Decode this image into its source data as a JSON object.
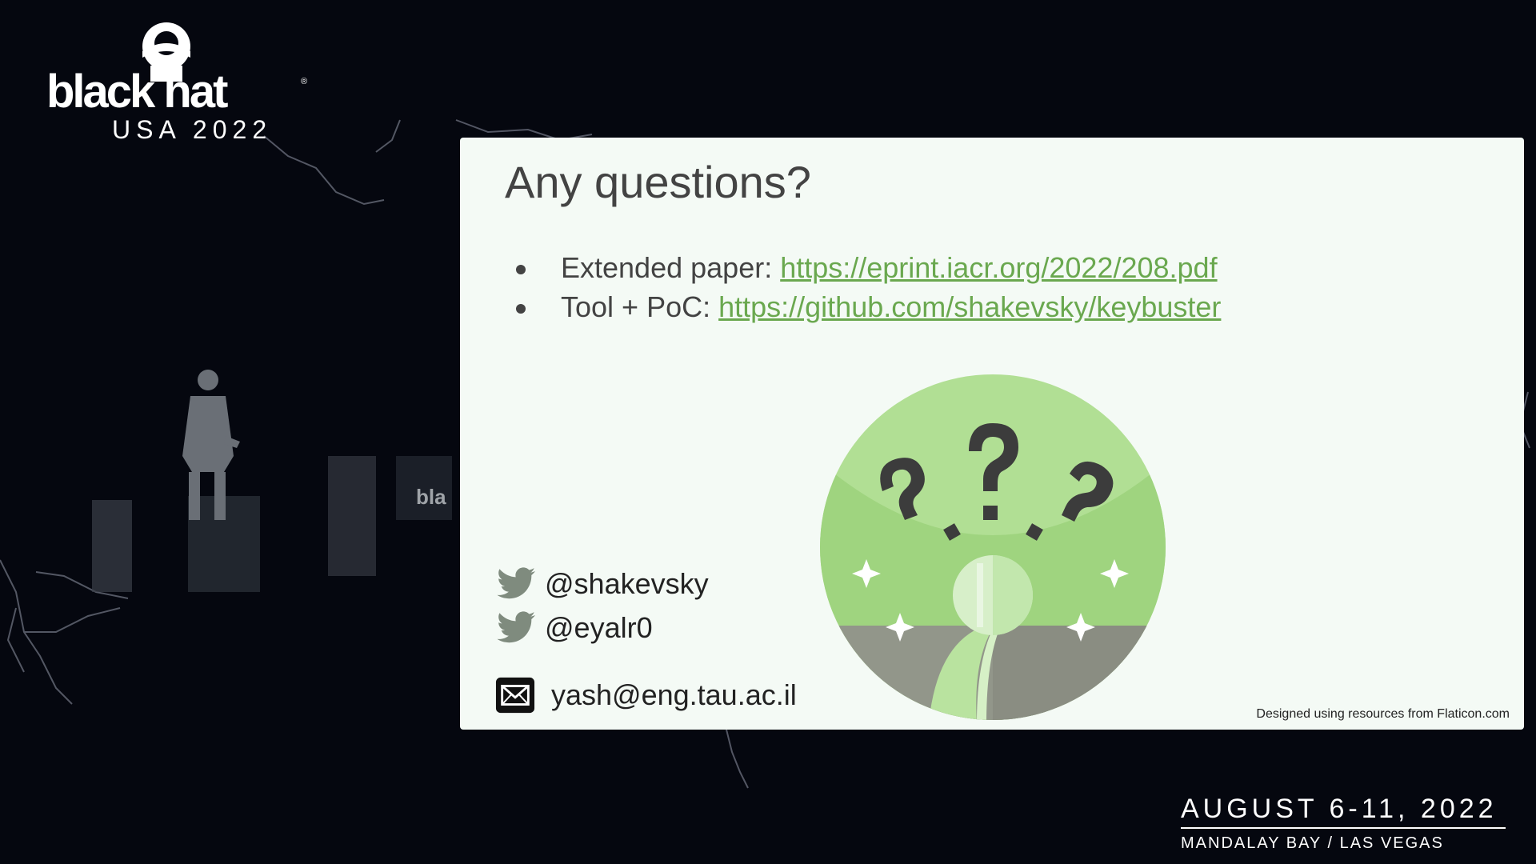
{
  "event": {
    "logo_wordmark": "black hat",
    "logo_subtitle": "USA 2022",
    "dates": "AUGUST 6-11, 2022",
    "venue": "MANDALAY BAY / LAS VEGAS"
  },
  "slide": {
    "title": "Any questions?",
    "bullets": [
      {
        "label": "Extended paper: ",
        "link": "https://eprint.iacr.org/2022/208.pdf"
      },
      {
        "label": "Tool + PoC: ",
        "link": "https://github.com/shakevsky/keybuster"
      }
    ],
    "contacts": [
      {
        "icon": "twitter-icon",
        "text": "@shakevsky"
      },
      {
        "icon": "twitter-icon",
        "text": "@eyalr0"
      },
      {
        "icon": "mail-icon",
        "text": "yash@eng.tau.ac.il"
      }
    ],
    "credit": "Designed using resources from Flaticon.com"
  },
  "colors": {
    "background": "#05070f",
    "slide_background": "#f4faf5",
    "link": "#6aa84f",
    "text": "#434343",
    "illustration_green": "#a8dc8c",
    "illustration_gray": "#8e9486"
  }
}
